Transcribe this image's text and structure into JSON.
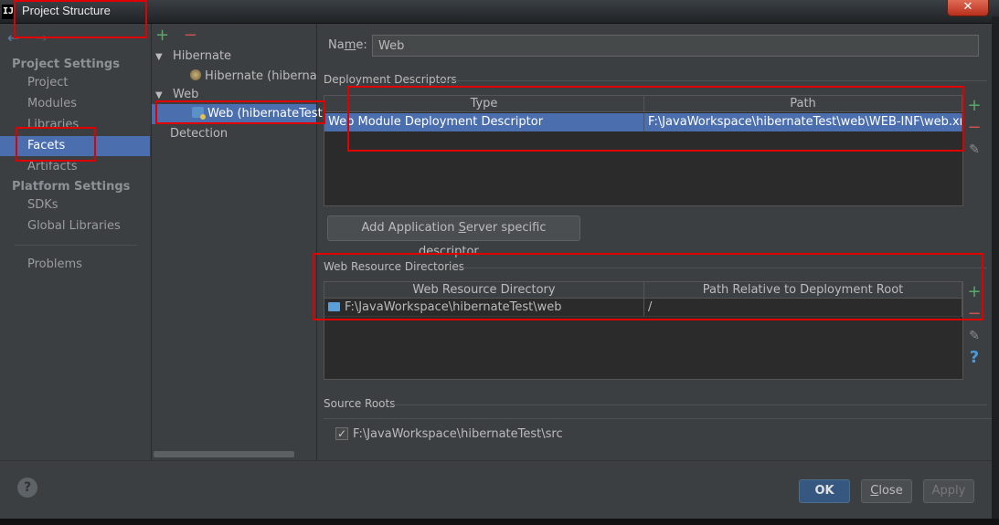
{
  "window": {
    "icon_text": "IJ",
    "title": "Project Structure",
    "close_glyph": "✕"
  },
  "nav": {
    "arrows": [
      "←",
      "→"
    ],
    "project_settings_header": "Project Settings",
    "project_items": [
      "Project",
      "Modules",
      "Libraries",
      "Facets",
      "Artifacts"
    ],
    "platform_settings_header": "Platform Settings",
    "platform_items": [
      "SDKs",
      "Global Libraries"
    ],
    "problems": "Problems",
    "selected": "Facets"
  },
  "tree": {
    "add_glyph": "+",
    "remove_glyph": "−",
    "nodes": [
      {
        "label": "Hibernate",
        "toggle": "▼"
      },
      {
        "label": "Hibernate (hibernateTest)"
      },
      {
        "label": "Web",
        "toggle": "▼"
      },
      {
        "label": "Web (hibernateTest)"
      },
      {
        "label": "Detection"
      }
    ]
  },
  "facet": {
    "name_label_prefix": "Na",
    "name_label_mnemonic": "m",
    "name_label_suffix": "e:",
    "name_value": "Web"
  },
  "deployment": {
    "title": "Deployment Descriptors",
    "columns": [
      "Type",
      "Path"
    ],
    "rows": [
      {
        "type": "Web Module Deployment Descriptor",
        "path": "F:\\JavaWorkspace\\hibernateTest\\web\\WEB-INF\\web.xml"
      }
    ],
    "add_button_prefix": "Add Application ",
    "add_button_mnemonic": "S",
    "add_button_suffix": "erver specific descriptor..."
  },
  "web_resources": {
    "title": "Web Resource Directories",
    "columns": [
      "Web Resource Directory",
      "Path Relative to Deployment Root"
    ],
    "rows": [
      {
        "directory": "F:\\JavaWorkspace\\hibernateTest\\web",
        "relative": "/"
      }
    ]
  },
  "source_roots": {
    "title": "Source Roots",
    "items": [
      {
        "path": "F:\\JavaWorkspace\\hibernateTest\\src",
        "checked": true,
        "check_glyph": "✓"
      }
    ]
  },
  "side_tools": {
    "add": "+",
    "remove": "−",
    "edit": "✎",
    "help": "?"
  },
  "footer": {
    "help": "?",
    "ok": "OK",
    "close_mnemonic": "C",
    "close_rest": "lose",
    "apply": "Apply"
  }
}
